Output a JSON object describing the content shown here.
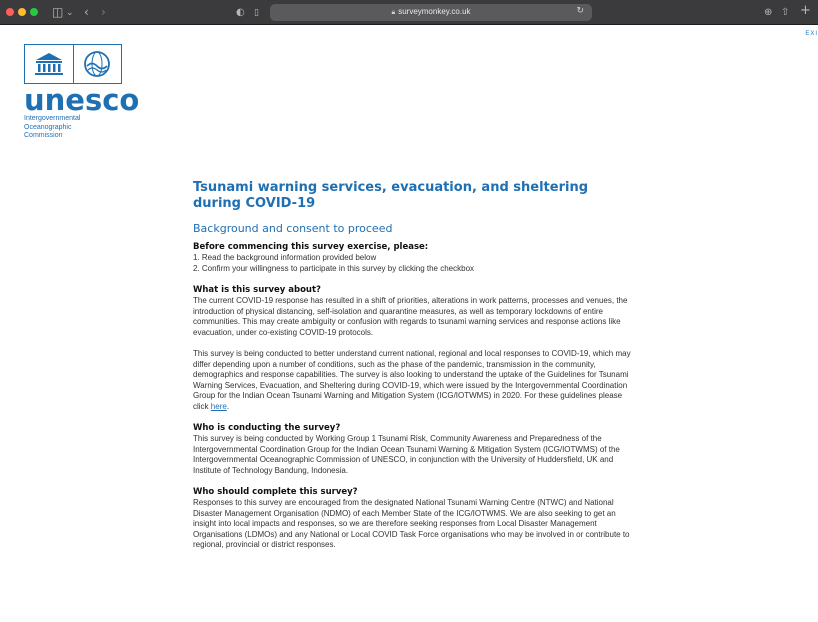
{
  "browser": {
    "url": "surveymonkey.co.uk"
  },
  "exit_label": "EXI",
  "logo": {
    "wordmark": "unesco",
    "sub_lines": [
      "Intergovernmental",
      "Oceanographic",
      "Commission"
    ]
  },
  "survey": {
    "title": "Tsunami warning services, evacuation, and sheltering during COVID-19",
    "page_title": "Background and consent to proceed",
    "before_heading": "Before commencing this survey exercise, please:",
    "steps": [
      "1. Read the background information provided below",
      "2. Confirm your willingness to participate in this survey by clicking the checkbox"
    ],
    "about_heading": "What is this survey about?",
    "about_p1": "The current COVID-19 response has resulted in a shift of priorities, alterations in work patterns, processes and venues, the introduction of physical distancing, self-isolation and quarantine measures, as well as temporary lockdowns of entire communities. This may create ambiguity or confusion with regards to tsunami warning services and response actions like evacuation, under co-existing COVID-19 protocols.",
    "about_p2": "This survey is being conducted to better understand current national, regional and local responses to COVID-19, which may differ depending upon a number of conditions, such as the phase of the pandemic, transmission in the community, demographics and response capabilities. The survey is also looking to understand the uptake of the Guidelines for Tsunami Warning Services, Evacuation, and Sheltering during COVID-19, which were issued by the Intergovernmental Coordination Group for the Indian Ocean Tsunami Warning and Mitigation System (ICG/IOTWMS) in 2020. For these guidelines please click",
    "about_link": "here",
    "who_heading": "Who is conducting the survey?",
    "who_p": "This survey is being conducted by Working Group 1 Tsunami Risk, Community Awareness and Preparedness of the Intergovernmental Coordination Group for the Indian Ocean Tsunami Warning & Mitigation System (ICG/IOTWMS) of the Intergovernmental Oceanographic Commission of UNESCO, in conjunction with the University of Huddersfield, UK and Institute of Technology Bandung, Indonesia.",
    "complete_heading": "Who should complete this survey?",
    "complete_p": "Responses to this survey are encouraged from the designated National Tsunami Warning Centre (NTWC) and National Disaster Management Organisation (NDMO) of each Member State of the ICG/IOTWMS. We are also seeking to get an insight into local impacts and responses, so we are therefore seeking responses from Local Disaster Management Organisations (LDMOs) and any National or Local COVID Task Force organisations who may be involved in or contribute to regional, provincial or district responses."
  }
}
